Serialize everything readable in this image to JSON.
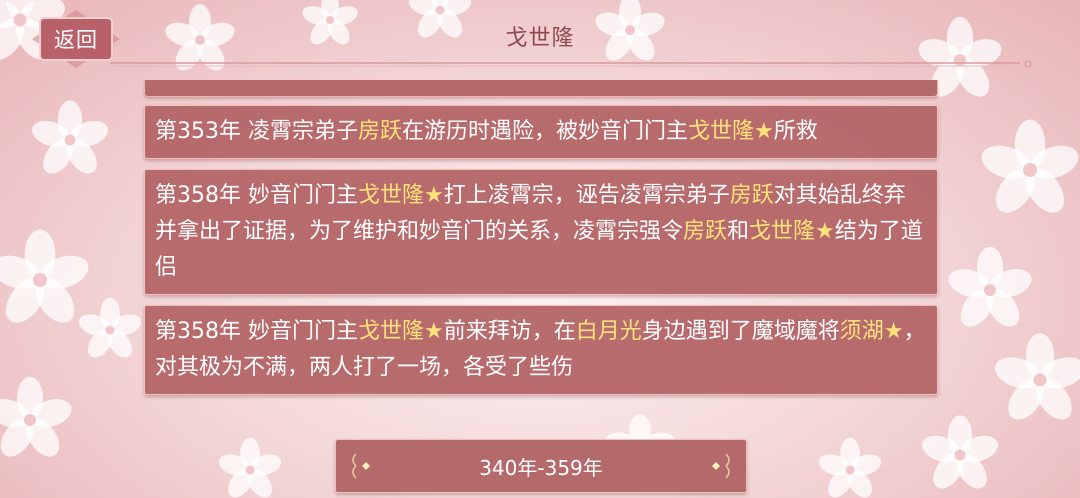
{
  "header": {
    "back_label": "返回",
    "title": "戈世隆"
  },
  "events": [
    {
      "segments": [
        {
          "text": "第353年 凌霄宗弟子",
          "hl": false
        },
        {
          "text": "房跃",
          "hl": true
        },
        {
          "text": "在游历时遇险，被妙音门门主",
          "hl": false
        },
        {
          "text": "戈世隆★",
          "hl": true
        },
        {
          "text": "所救",
          "hl": false
        }
      ]
    },
    {
      "segments": [
        {
          "text": "第358年 妙音门门主",
          "hl": false
        },
        {
          "text": "戈世隆★",
          "hl": true
        },
        {
          "text": "打上凌霄宗，诬告凌霄宗弟子",
          "hl": false
        },
        {
          "text": "房跃",
          "hl": true
        },
        {
          "text": "对其始乱终弃并拿出了证据，为了维护和妙音门的关系，凌霄宗强令",
          "hl": false
        },
        {
          "text": "房跃",
          "hl": true
        },
        {
          "text": "和",
          "hl": false
        },
        {
          "text": "戈世隆★",
          "hl": true
        },
        {
          "text": "结为了道侣",
          "hl": false
        }
      ]
    },
    {
      "segments": [
        {
          "text": "第358年 妙音门门主",
          "hl": false
        },
        {
          "text": "戈世隆★",
          "hl": true
        },
        {
          "text": "前来拜访，在",
          "hl": false
        },
        {
          "text": "白月光",
          "hl": true
        },
        {
          "text": "身边遇到了魔域魔将",
          "hl": false
        },
        {
          "text": "须湖★",
          "hl": true
        },
        {
          "text": "，对其极为不满，两人打了一场，各受了些伤",
          "hl": false
        }
      ]
    }
  ],
  "pager": {
    "label": "340年-359年"
  },
  "colors": {
    "panel": "#b46a6a",
    "highlight": "#ffe27a",
    "title": "#8c4a4f"
  }
}
